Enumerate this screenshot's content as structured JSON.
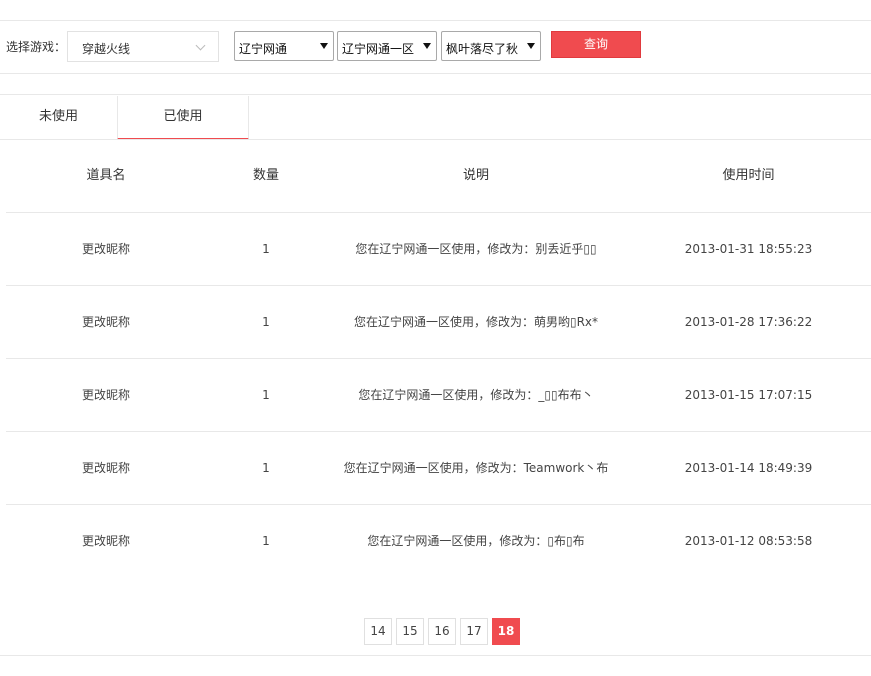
{
  "filter": {
    "label": "选择游戏：",
    "game": "穿越火线",
    "region": "辽宁网通",
    "server": "辽宁网通一区",
    "role": "枫叶落尽了秋",
    "query_label": "查询"
  },
  "tabs": [
    {
      "label": "未使用"
    },
    {
      "label": "已使用"
    }
  ],
  "table": {
    "headers": [
      "道具名",
      "数量",
      "说明",
      "使用时间"
    ],
    "rows": [
      {
        "item": "更改昵称",
        "qty": "1",
        "desc": "您在辽宁网通一区使用，修改为：别丢近乎▯▯",
        "time": "2013-01-31 18:55:23"
      },
      {
        "item": "更改昵称",
        "qty": "1",
        "desc": "您在辽宁网通一区使用，修改为：萌男哟▯Rx*",
        "time": "2013-01-28 17:36:22"
      },
      {
        "item": "更改昵称",
        "qty": "1",
        "desc": "您在辽宁网通一区使用，修改为：_▯▯布布丶",
        "time": "2013-01-15 17:07:15"
      },
      {
        "item": "更改昵称",
        "qty": "1",
        "desc": "您在辽宁网通一区使用，修改为：Teamwork丶布",
        "time": "2013-01-14 18:49:39"
      },
      {
        "item": "更改昵称",
        "qty": "1",
        "desc": "您在辽宁网通一区使用，修改为：▯布▯布",
        "time": "2013-01-12 08:53:58"
      }
    ]
  },
  "pagination": {
    "pages": [
      "14",
      "15",
      "16",
      "17",
      "18"
    ],
    "current": "18"
  },
  "colors": {
    "accent": "#f04b4f",
    "border": "#e8e8e8"
  }
}
